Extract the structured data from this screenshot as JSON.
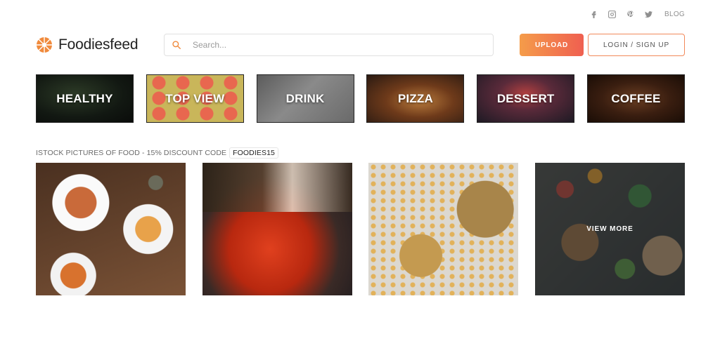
{
  "social": {
    "icons": [
      "facebook-icon",
      "instagram-icon",
      "pinterest-icon",
      "twitter-icon"
    ],
    "blog_label": "BLOG"
  },
  "header": {
    "brand": "Foodiesfeed",
    "search_placeholder": "Search...",
    "upload_label": "UPLOAD",
    "login_label": "LOGIN / SIGN UP"
  },
  "categories": [
    {
      "label": "HEALTHY"
    },
    {
      "label": "TOP VIEW"
    },
    {
      "label": "DRINK"
    },
    {
      "label": "PIZZA"
    },
    {
      "label": "DESSERT"
    },
    {
      "label": "COFFEE"
    }
  ],
  "promo": {
    "text": "ISTOCK PICTURES OF FOOD - 15% DISCOUNT CODE",
    "code": "FOODIES15"
  },
  "gallery": {
    "view_more_label": "VIEW MORE"
  },
  "colors": {
    "accent_start": "#f59c4a",
    "accent_end": "#ef5f50",
    "login_border": "#f2895a"
  }
}
